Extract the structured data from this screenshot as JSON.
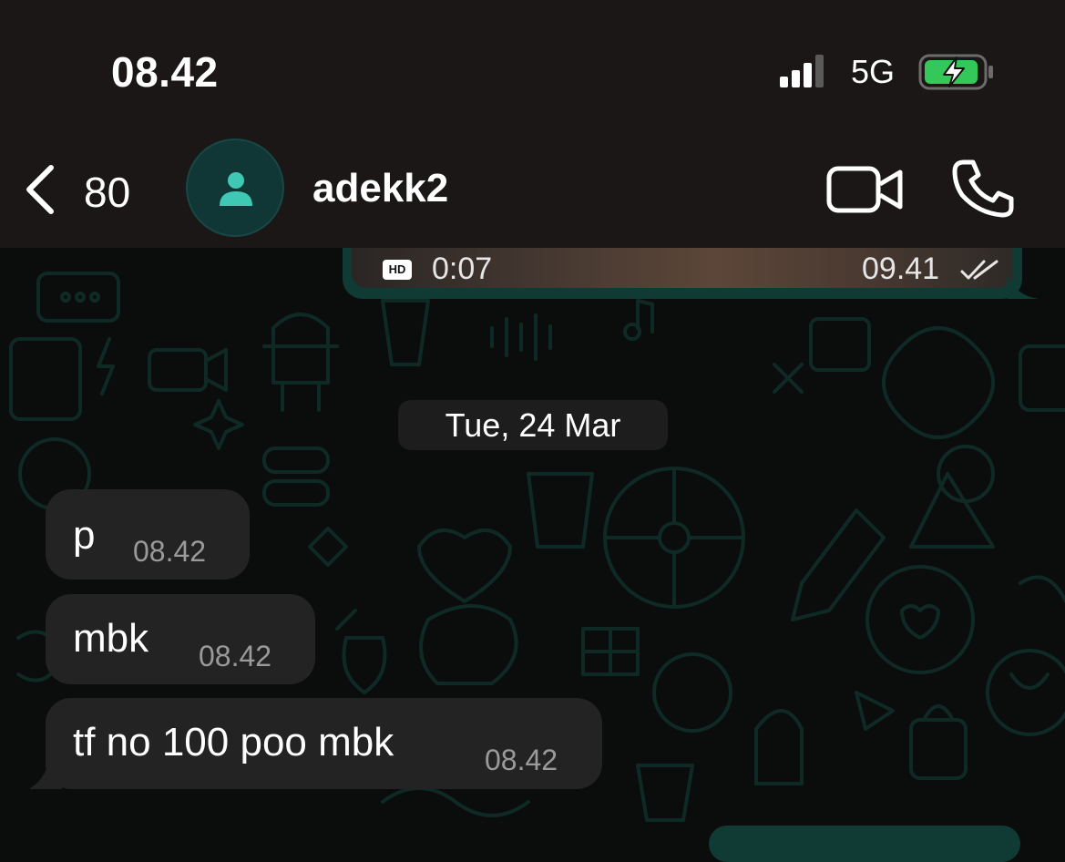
{
  "status_bar": {
    "time": "08.42",
    "network": "5G",
    "battery_charging": true
  },
  "header": {
    "back_count": "80",
    "contact_name": "adekk2"
  },
  "previous_message": {
    "type": "video",
    "quality_badge": "HD",
    "duration": "0:07",
    "time": "09.41",
    "read": true
  },
  "date_separator": "Tue, 24 Mar",
  "messages": [
    {
      "text": "p",
      "time": "08.42",
      "direction": "incoming"
    },
    {
      "text": "mbk",
      "time": "08.42",
      "direction": "incoming"
    },
    {
      "text": "tf no 100 poo mbk",
      "time": "08.42",
      "direction": "incoming"
    }
  ],
  "colors": {
    "bar_bg": "#1a1716",
    "incoming_bubble": "#232323",
    "outgoing_bubble": "#103b34",
    "accent": "#3fc9b5"
  }
}
